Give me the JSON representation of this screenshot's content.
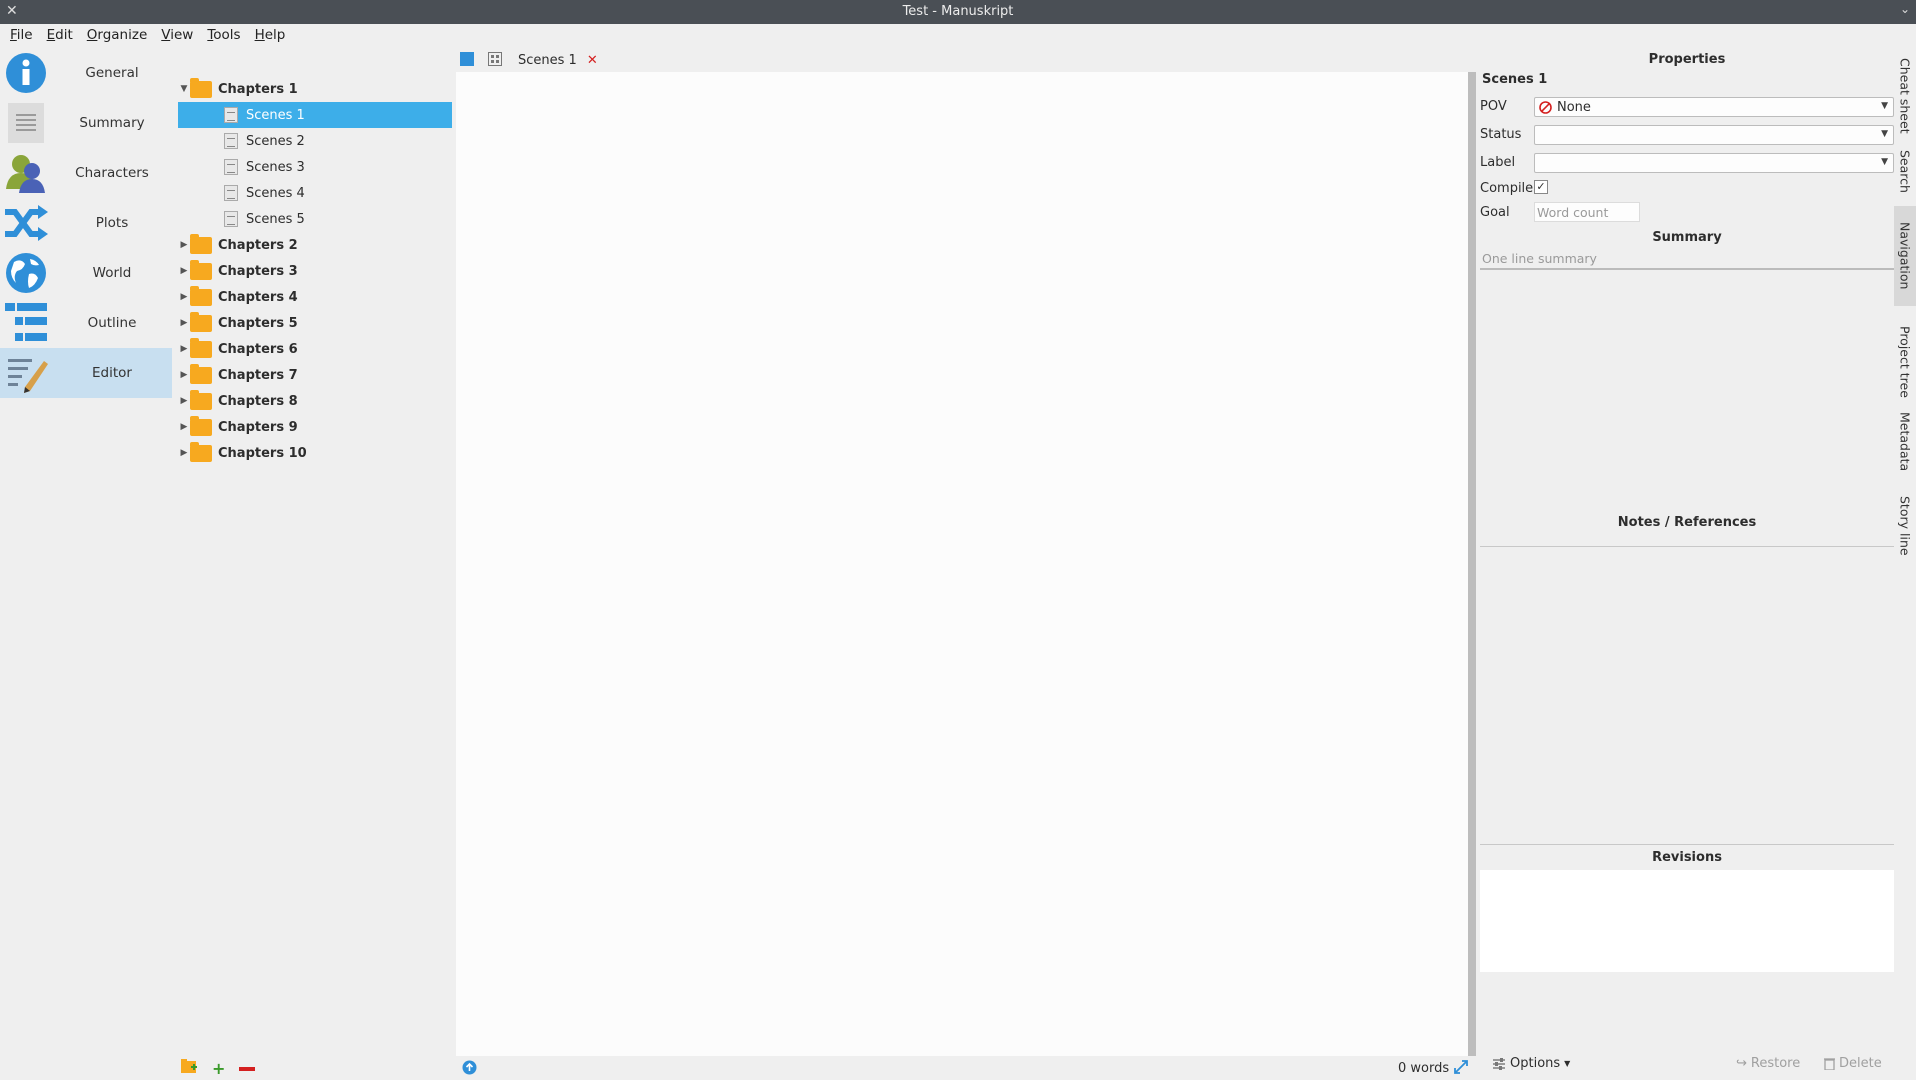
{
  "window": {
    "title": "Test - Manuskript"
  },
  "menu": [
    {
      "key": "F",
      "rest": "ile"
    },
    {
      "key": "E",
      "rest": "dit"
    },
    {
      "key": "O",
      "rest": "rganize"
    },
    {
      "key": "V",
      "rest": "iew"
    },
    {
      "key": "T",
      "rest": "ools"
    },
    {
      "key": "H",
      "rest": "elp"
    }
  ],
  "nav": [
    {
      "label": "General",
      "icon": "info-icon"
    },
    {
      "label": "Summary",
      "icon": "summary-icon"
    },
    {
      "label": "Characters",
      "icon": "characters-icon"
    },
    {
      "label": "Plots",
      "icon": "plots-icon"
    },
    {
      "label": "World",
      "icon": "world-icon"
    },
    {
      "label": "Outline",
      "icon": "outline-icon"
    },
    {
      "label": "Editor",
      "icon": "editor-icon"
    }
  ],
  "tree": {
    "chapters1": "Chapters 1",
    "scenes": [
      "Scenes 1",
      "Scenes 2",
      "Scenes 3",
      "Scenes 4",
      "Scenes 5"
    ],
    "chapters": [
      "Chapters 2",
      "Chapters 3",
      "Chapters 4",
      "Chapters 5",
      "Chapters 6",
      "Chapters 7",
      "Chapters 8",
      "Chapters 9",
      "Chapters 10"
    ]
  },
  "editor": {
    "tab_label": "Scenes 1",
    "word_count": "0 words"
  },
  "properties": {
    "header": "Properties",
    "item_title": "Scenes 1",
    "pov_label": "POV",
    "pov_value": "None",
    "status_label": "Status",
    "label_label": "Label",
    "compile_label": "Compile",
    "compile_mark": "✓",
    "goal_label": "Goal",
    "goal_placeholder": "Word count",
    "summary_header": "Summary",
    "summary_placeholder": "One line summary",
    "notes_header": "Notes / References",
    "revisions_header": "Revisions",
    "options_label": "Options",
    "restore_label": "Restore",
    "delete_label": "Delete"
  },
  "dock_tabs": [
    "Cheat sheet",
    "Search",
    "Navigation",
    "Project tree",
    "Metadata",
    "Story line"
  ],
  "colors": {
    "accent": "#3daee9",
    "folder": "#f7a91f",
    "titlebar": "#4a4f55"
  }
}
